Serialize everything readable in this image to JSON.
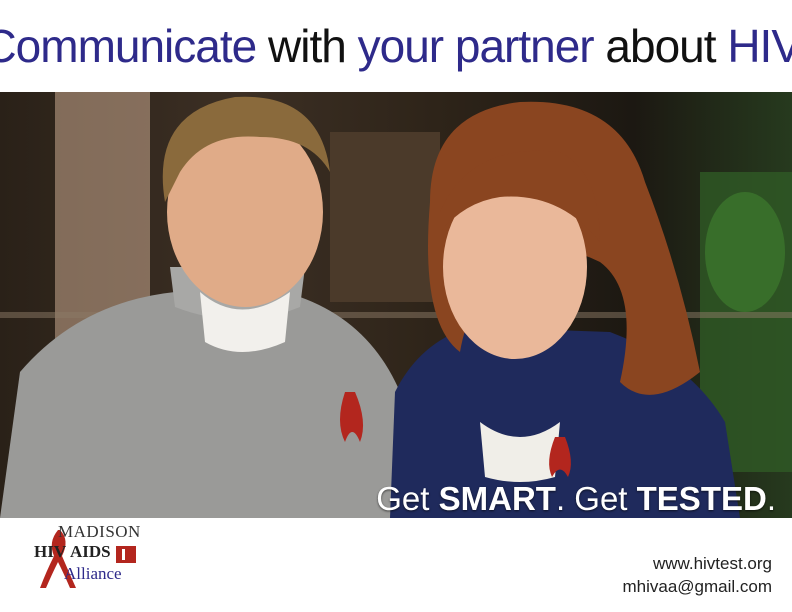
{
  "headline": {
    "part1": "Communicate",
    "part2": " with ",
    "part3": "your partner",
    "part4": " about ",
    "part5": "HIV."
  },
  "tagline": {
    "get1": "Get ",
    "smart": "SMART",
    "mid": ". Get ",
    "tested": "TESTED",
    "end": "."
  },
  "logo": {
    "madison": "MADISON",
    "hiv": "HIV",
    "aids": "AIDS",
    "alliance": "Alliance"
  },
  "contact": {
    "website": "www.hivtest.org",
    "email": "mhivaa@gmail.com"
  },
  "colors": {
    "headline_blue": "#2e2a8a",
    "ribbon_red": "#b3261e"
  }
}
